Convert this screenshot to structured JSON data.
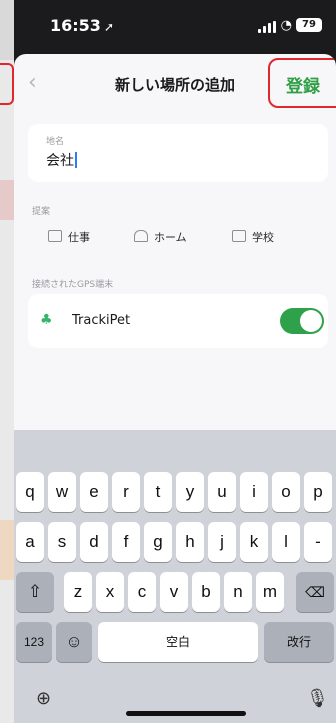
{
  "status_bar": {
    "time": "16:53",
    "battery": "79"
  },
  "nav": {
    "title": "新しい場所の追加",
    "register": "登録"
  },
  "name_field": {
    "label": "地名",
    "value": "会社"
  },
  "suggestions": {
    "label": "提案",
    "items": [
      {
        "label": "仕事",
        "icon": "briefcase-icon"
      },
      {
        "label": "ホーム",
        "icon": "home-icon"
      },
      {
        "label": "学校",
        "icon": "book-icon"
      }
    ]
  },
  "gps": {
    "label": "接続されたGPS端末",
    "device": "TrackiPet",
    "enabled": true
  },
  "keyboard": {
    "row1": [
      "q",
      "w",
      "e",
      "r",
      "t",
      "y",
      "u",
      "i",
      "o",
      "p"
    ],
    "row2": [
      "a",
      "s",
      "d",
      "f",
      "g",
      "h",
      "j",
      "k",
      "l",
      "-"
    ],
    "row3": [
      "z",
      "x",
      "c",
      "v",
      "b",
      "n",
      "m"
    ],
    "numbers": "123",
    "space": "空白",
    "return": "改行"
  },
  "colors": {
    "accent": "#2f9e44",
    "highlight": "#e0282c"
  }
}
